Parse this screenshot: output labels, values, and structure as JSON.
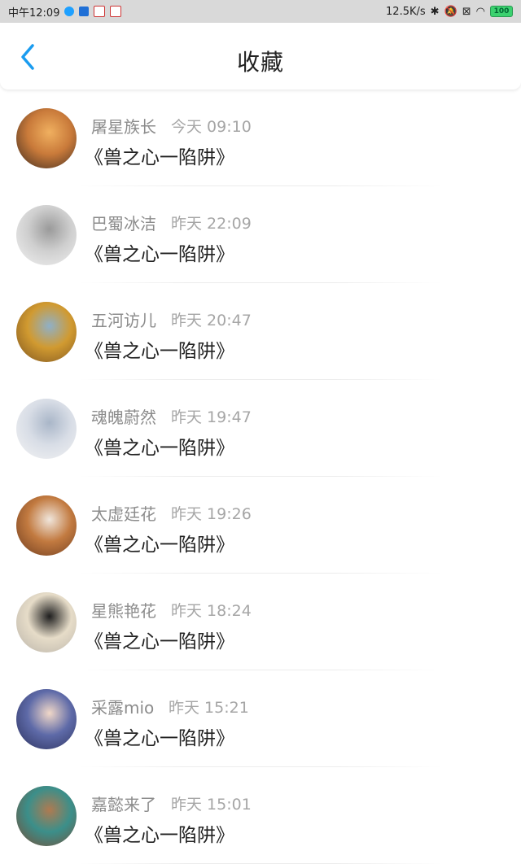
{
  "status_bar": {
    "time": "中午12:09",
    "network_speed": "12.5K/s",
    "battery": "100"
  },
  "header": {
    "title": "收藏"
  },
  "items": [
    {
      "name": "屠星族长",
      "time": "今天 09:10",
      "message": "《兽之心一陷阱》",
      "avatar_colors": [
        "#3a2a20",
        "#c97a3a",
        "#f0b060"
      ]
    },
    {
      "name": "巴蜀冰洁",
      "time": "昨天 22:09",
      "message": "《兽之心一陷阱》",
      "avatar_colors": [
        "#f2f2f2",
        "#cfcfcf",
        "#9a9a9a"
      ]
    },
    {
      "name": "五河访儿",
      "time": "昨天 20:47",
      "message": "《兽之心一陷阱》",
      "avatar_colors": [
        "#7a5220",
        "#d19a30",
        "#8fb0c8"
      ]
    },
    {
      "name": "魂魄蔚然",
      "time": "昨天 19:47",
      "message": "《兽之心一陷阱》",
      "avatar_colors": [
        "#f4f4f4",
        "#d8dde6",
        "#a9b6c8"
      ]
    },
    {
      "name": "太虚廷花",
      "time": "昨天 19:26",
      "message": "《兽之心一陷阱》",
      "avatar_colors": [
        "#6b3a1e",
        "#c27a40",
        "#f0e6dc"
      ]
    },
    {
      "name": "星熊艳花",
      "time": "昨天 18:24",
      "message": "《兽之心一陷阱》",
      "avatar_colors": [
        "#b8b2a8",
        "#e6dcc8",
        "#1e1e1e"
      ]
    },
    {
      "name": "采露mio",
      "time": "昨天 15:21",
      "message": "《兽之心一陷阱》",
      "avatar_colors": [
        "#2a2f5a",
        "#5e6aa8",
        "#f1d8c8"
      ]
    },
    {
      "name": "嘉懿来了",
      "time": "昨天 15:01",
      "message": "《兽之心一陷阱》",
      "avatar_colors": [
        "#7b4a32",
        "#3b8f8a",
        "#b07a50"
      ]
    }
  ]
}
